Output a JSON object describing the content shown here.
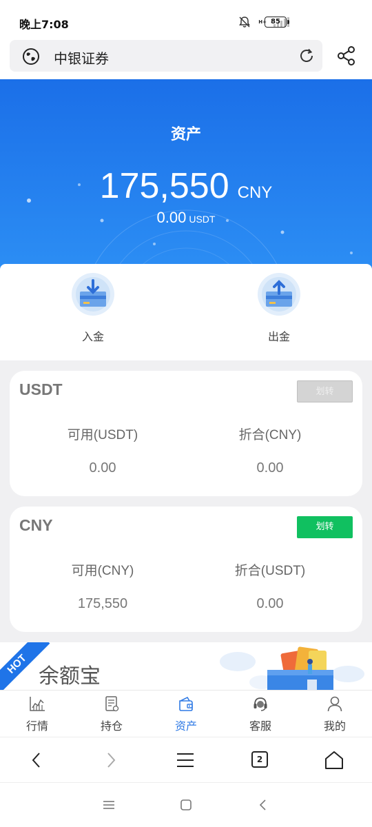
{
  "status_bar": {
    "time": "晚上7:08",
    "network_label": "H+",
    "battery": "85"
  },
  "browser": {
    "page_title": "中银证券",
    "open_tabs": "2"
  },
  "hero": {
    "title": "资产",
    "total_amount": "175,550",
    "total_unit": "CNY",
    "usdt_amount": "0.00",
    "usdt_unit": "USDT"
  },
  "actions": [
    {
      "label": "入金"
    },
    {
      "label": "出金"
    }
  ],
  "accounts": [
    {
      "title": "USDT",
      "transfer_label": "划转",
      "transfer_enabled": false,
      "columns": [
        {
          "label": "可用(USDT)",
          "value": "0.00"
        },
        {
          "label": "折合(CNY)",
          "value": "0.00"
        }
      ]
    },
    {
      "title": "CNY",
      "transfer_label": "划转",
      "transfer_enabled": true,
      "columns": [
        {
          "label": "可用(CNY)",
          "value": "175,550"
        },
        {
          "label": "折合(USDT)",
          "value": "0.00"
        }
      ]
    }
  ],
  "promo": {
    "badge": "HOT",
    "title": "余额宝"
  },
  "tabs": [
    {
      "label": "行情",
      "icon": "chart-icon",
      "active": false
    },
    {
      "label": "持仓",
      "icon": "document-icon",
      "active": false
    },
    {
      "label": "资产",
      "icon": "wallet-icon",
      "active": true
    },
    {
      "label": "客服",
      "icon": "headset-icon",
      "active": false
    },
    {
      "label": "我的",
      "icon": "person-icon",
      "active": false
    }
  ],
  "colors": {
    "brand_blue": "#1b6fe8",
    "active_tab": "#2f7ae5",
    "transfer_green": "#10c060",
    "disabled_grey": "#d4d4d4"
  }
}
